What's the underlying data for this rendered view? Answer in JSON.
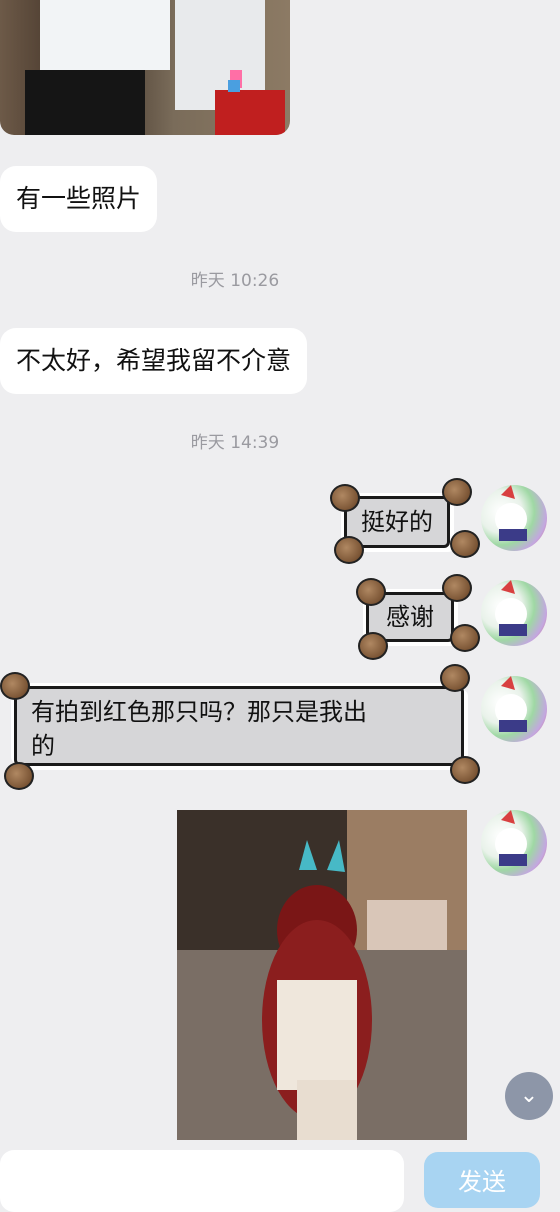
{
  "messages": {
    "m1": "有一些照片",
    "t1": "昨天 10:26",
    "m2": "不太好，希望我留不介意",
    "t2": "昨天 14:39",
    "m3": "挺好的",
    "m4": "感谢",
    "m5_line1": "有拍到红色那只吗？那只是我出",
    "m5_line2": "的"
  },
  "composer": {
    "send_label": "发送"
  },
  "icons": {
    "scroll_down": "chevron-down-icon",
    "avatar": "avatar-icon",
    "sticker_decor": "hamster-icon"
  },
  "colors": {
    "background": "#eeeef0",
    "bubble_left": "#ffffff",
    "deco_bubble": "#d6d6d8",
    "send_button": "#a8d4f2",
    "scroll_button": "#8d96a8"
  }
}
